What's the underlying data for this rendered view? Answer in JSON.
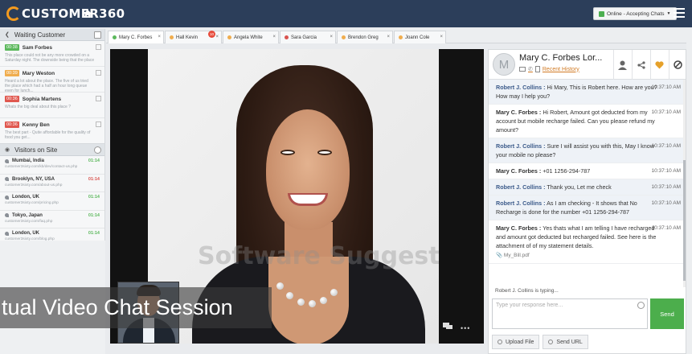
{
  "app": {
    "brand": "CUSTOMER360",
    "status": "Online - Accepting Chats"
  },
  "waiting": {
    "title": "Waiting Customer",
    "items": [
      {
        "time": "00:38",
        "time_color": "#5cb85c",
        "name": "Sam Forbes",
        "msg": "This place could not be any more crowded on a Saturday night. The downside being that the place is small..."
      },
      {
        "time": "00:39",
        "time_color": "#f0ad4e",
        "name": "Mary Weston",
        "msg": "Heard a lot about the place. The five of us tried the place which had a half an hour long queue even for lunch..."
      },
      {
        "time": "00:36",
        "time_color": "#e0584f",
        "name": "Sophia Martens",
        "msg": "Whats the big deal about this place ?"
      },
      {
        "time": "00:36",
        "time_color": "#e0584f",
        "name": "Kenny Ben",
        "msg": "The best part - Quite affordable for the quality of food you get..."
      }
    ]
  },
  "visitors": {
    "title": "Visitors on Site",
    "items": [
      {
        "loc": "Mumbai, India",
        "url": "customer3sixty.com/kb/dev/contact-us.php",
        "time": "01:14",
        "time_color": "#5cb85c"
      },
      {
        "loc": "Brooklyn, NY, USA",
        "url": "customer3sixty.com/about-us.php",
        "time": "01:14",
        "time_color": "#d9534f"
      },
      {
        "loc": "London, UK",
        "url": "customer3sixty.com/pricing.php",
        "time": "01:14",
        "time_color": "#5cb85c"
      },
      {
        "loc": "Tokyo, Japan",
        "url": "customer3sixty.com/faq.php",
        "time": "01:14",
        "time_color": "#5cb85c"
      },
      {
        "loc": "London, UK",
        "url": "customer3sixty.com/blog.php",
        "time": "01:14",
        "time_color": "#5cb85c"
      }
    ]
  },
  "tabs": [
    {
      "label": "Mary C. Forbes",
      "dot": "#5cb85c"
    },
    {
      "label": "Hall Kevin",
      "dot": "#f0ad4e",
      "badge": "10"
    },
    {
      "label": "Angela White",
      "dot": "#f0ad4e"
    },
    {
      "label": "Sara Garcia",
      "dot": "#d9534f"
    },
    {
      "label": "Brendon Greg",
      "dot": "#f0ad4e"
    },
    {
      "label": "Joann Cole",
      "dot": "#f0ad4e"
    }
  ],
  "video": {
    "caption": "tual Video Chat Session",
    "watermark": "Software Suggest"
  },
  "chat": {
    "name": "Mary C. Forbes Lor...",
    "recent": "Recent History",
    "messages": [
      {
        "who": "Robert J. Collins :",
        "text": "Hi Mary, This is Robert here. How are you? How may I help you?",
        "time": "10:37:10 AM",
        "agent": true
      },
      {
        "who": "Mary C. Forbes :",
        "text": "Hi Robert, Amount got deducted from my account but mobile recharge failed. Can you please refund my amount?",
        "time": "10:37:10 AM",
        "agent": false
      },
      {
        "who": "Robert J. Collins :",
        "text": "Sure I will assist you with this, May I know your mobile no please?",
        "time": "10:37:10 AM",
        "agent": true
      },
      {
        "who": "Mary C. Forbes :",
        "text": "+01 1256-294-787",
        "time": "10:37:10 AM",
        "agent": false
      },
      {
        "who": "Robert J. Collins :",
        "text": "Thank you, Let me check",
        "time": "10:37:10 AM",
        "agent": true
      },
      {
        "who": "Robert J. Collins :",
        "text": "As I am checking - It shows that No Recharge is done for the number +01 1256-294-787",
        "time": "10:37:10 AM",
        "agent": true
      },
      {
        "who": "Mary C. Forbes :",
        "text": "Yes thats what I am telling I have recharged and amount got deducted but recharged failed. See here is the attachment of of my statement details.",
        "time": "10:37:10 AM",
        "agent": false,
        "attachment": "My_Bill.pdf"
      }
    ],
    "typing": "Robert J. Collins is typing...",
    "placeholder": "Type your response here...",
    "send": "Send",
    "upload": "Upload File",
    "send_url": "Send URL"
  }
}
